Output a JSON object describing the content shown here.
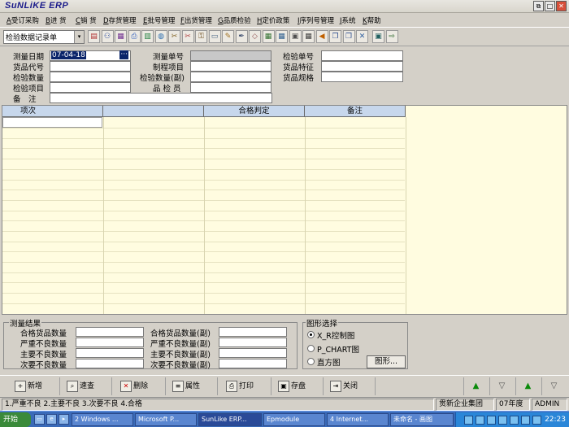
{
  "window": {
    "title": "SuNLiKE ERP",
    "btn_restore": "⧉",
    "btn_max": "□",
    "btn_close": "✕"
  },
  "menu": [
    {
      "key": "A",
      "label": "受订采购"
    },
    {
      "key": "B",
      "label": "进 货"
    },
    {
      "key": "C",
      "label": "销 货"
    },
    {
      "key": "D",
      "label": "存货管理"
    },
    {
      "key": "E",
      "label": "批号管理"
    },
    {
      "key": "F",
      "label": "出货管理"
    },
    {
      "key": "G",
      "label": "品质检验"
    },
    {
      "key": "H",
      "label": "定价政策"
    },
    {
      "key": "I",
      "label": "序列号管理"
    },
    {
      "key": "J",
      "label": "系统"
    },
    {
      "key": "K",
      "label": "帮助"
    }
  ],
  "toolbar": {
    "form_select": "检验数据记录单",
    "arrow": "▾"
  },
  "toolbar_icons": [
    "book-icon",
    "users-icon",
    "report-icon",
    "printer-icon",
    "chart-icon",
    "globe-icon",
    "tools-icon",
    "scissors-icon",
    "key-icon",
    "document-icon",
    "pencil-icon",
    "pen-icon",
    "eraser-icon",
    "table-icon",
    "grid-icon",
    "box-icon",
    "calculator-icon",
    "speaker-icon",
    "copy-icon",
    "window-icon",
    "close-doc-icon",
    "screen-icon",
    "exit-icon"
  ],
  "form": {
    "measure_date_label": "测量日期",
    "measure_date_value": "07-04-18",
    "date_picker": "···",
    "item_code_label": "货品代号",
    "inspect_qty_label": "检验数量",
    "inspect_item_label": "检验项目",
    "remark_label": "备　注",
    "measure_no_label": "测量单号",
    "process_item_label": "制程项目",
    "inspect_qty_sub_label": "检验数量(副)",
    "inspector_label": "品 检 员",
    "inspect_no_label": "检验单号",
    "item_feature_label": "货品特征",
    "item_spec_label": "货品规格"
  },
  "grid": {
    "columns": [
      "项次",
      "",
      "合格判定",
      "备注"
    ]
  },
  "results": {
    "title": "测量结果",
    "qualified_qty": "合格货品数量",
    "severe_bad": "严重不良数量",
    "major_bad": "主要不良数量",
    "minor_bad": "次要不良数量",
    "qualified_qty_sub": "合格货品数量(副)",
    "severe_bad_sub": "严重不良数量(副)",
    "major_bad_sub": "主要不良数量(副)",
    "minor_bad_sub": "次要不良数量(副)"
  },
  "chart_select": {
    "title": "图形选择",
    "opt_xr": "X_R控制图",
    "opt_p": "P_CHART图",
    "opt_hist": "直方图",
    "graph_btn": "图形..."
  },
  "actions": {
    "add": "新增",
    "query": "速查",
    "delete": "删除",
    "property": "属性",
    "print": "打印",
    "save": "存盘",
    "close": "关闭"
  },
  "nav": {
    "first": "▲",
    "prev": "▽",
    "next": "▲",
    "last": "▽"
  },
  "status": {
    "hint": "1.严重不良 2.主要不良 3.次要不良 4.合格",
    "company": "贯新企业集团",
    "year": "07年度",
    "user": "ADMIN"
  },
  "taskbar": {
    "start": "开始",
    "items": [
      "2 Windows ...",
      "Microsoft P...",
      "SunLike ERP...",
      "Epmodule",
      "4 Internet...",
      "未命名 - 画图"
    ],
    "clock": "22:23"
  },
  "colors": {
    "grid_bg": "#fffce0",
    "grid_header": "#c7d7ec",
    "taskbar": "#3a6ab8"
  }
}
